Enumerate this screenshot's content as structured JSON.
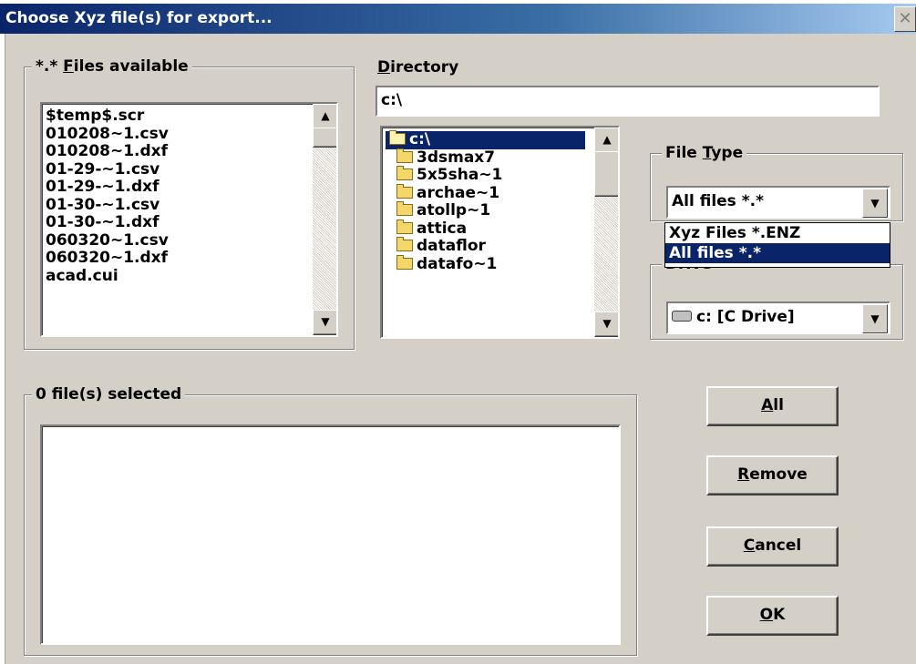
{
  "window": {
    "title": "Choose Xyz file(s) for export...",
    "close_glyph": "✕"
  },
  "files_available": {
    "legend_prefix": "*.* ",
    "legend_mnemonic": "F",
    "legend_rest": "iles available",
    "items": [
      "$temp$.scr",
      "010208~1.csv",
      "010208~1.dxf",
      "01-29-~1.csv",
      "01-29-~1.dxf",
      "01-30-~1.csv",
      "01-30-~1.dxf",
      "060320~1.csv",
      "060320~1.dxf",
      "acad.cui"
    ]
  },
  "directory": {
    "label_mnemonic": "D",
    "label_rest": "irectory",
    "value": "c:\\",
    "tree": {
      "root": "c:\\",
      "folders": [
        "3dsmax7",
        "5x5sha~1",
        "archae~1",
        "atollp~1",
        "attica",
        "dataflor",
        "datafo~1"
      ]
    }
  },
  "file_type": {
    "label_prefix": "File ",
    "label_mnemonic": "T",
    "label_rest": "ype",
    "selected": "All files  *.*",
    "options": [
      "Xyz Files  *.ENZ",
      "All files  *.*"
    ],
    "highlighted_index": 1
  },
  "drive": {
    "label_visible": "Drive",
    "selected": "c: [C Drive]"
  },
  "selected_files": {
    "legend": "0 file(s) selected",
    "items": []
  },
  "buttons": {
    "all": {
      "mnemonic": "A",
      "rest": "ll"
    },
    "remove": {
      "mnemonic": "R",
      "rest": "emove"
    },
    "cancel": {
      "mnemonic": "C",
      "rest": "ancel"
    },
    "ok": {
      "mnemonic": "O",
      "rest": "K"
    }
  },
  "icons": {
    "scroll_up": "▲",
    "scroll_down": "▼",
    "combo_arrow": "▼"
  }
}
